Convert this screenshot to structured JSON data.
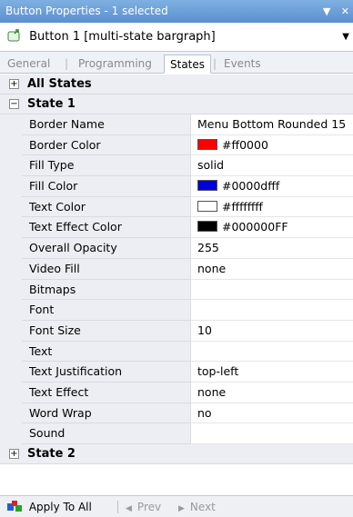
{
  "window": {
    "title": "Button Properties - 1 selected"
  },
  "selector": {
    "label": "Button 1  [multi-state bargraph]"
  },
  "tabs": [
    {
      "label": "General"
    },
    {
      "label": "Programming"
    },
    {
      "label": "States"
    },
    {
      "label": "Events"
    }
  ],
  "groups": {
    "all_states": {
      "label": "All States",
      "toggle": "+"
    },
    "state1": {
      "label": "State 1",
      "toggle": "−"
    },
    "state2": {
      "label": "State 2",
      "toggle": "+"
    }
  },
  "properties": [
    {
      "name": "Border Name",
      "value": "Menu Bottom Rounded 15"
    },
    {
      "name": "Border Color",
      "value": "#ff0000",
      "swatch": "#ff0000"
    },
    {
      "name": "Fill Type",
      "value": "solid"
    },
    {
      "name": "Fill Color",
      "value": "#0000dfff",
      "swatch": "#0000df"
    },
    {
      "name": "Text Color",
      "value": "#ffffffff",
      "swatch": "#ffffff"
    },
    {
      "name": "Text Effect Color",
      "value": "#000000FF",
      "swatch": "#000000"
    },
    {
      "name": "Overall Opacity",
      "value": "255"
    },
    {
      "name": "Video Fill",
      "value": "none"
    },
    {
      "name": "Bitmaps",
      "value": ""
    },
    {
      "name": "Font",
      "value": ""
    },
    {
      "name": "Font Size",
      "value": "10"
    },
    {
      "name": "Text",
      "value": ""
    },
    {
      "name": "Text Justification",
      "value": "top-left"
    },
    {
      "name": "Text Effect",
      "value": "none"
    },
    {
      "name": "Word Wrap",
      "value": "no"
    },
    {
      "name": "Sound",
      "value": ""
    }
  ],
  "footer": {
    "apply_all": "Apply To All",
    "prev": "Prev",
    "next": "Next"
  },
  "colors": {
    "titlebar": "#5b8fcf",
    "grid_name_bg": "#eceef3"
  }
}
